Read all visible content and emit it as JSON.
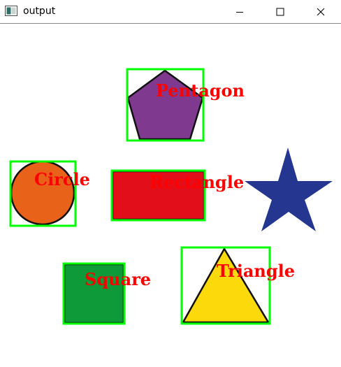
{
  "window": {
    "title": "output",
    "icon": "app-window-icon",
    "controls": {
      "minimize_icon": "minimize-icon",
      "maximize_icon": "maximize-icon",
      "close_icon": "close-icon"
    }
  },
  "canvas": {
    "background": "#ffffff",
    "bbox_color": "#00ff00",
    "label_color": "#ff0000",
    "shapes": {
      "pentagon": {
        "label": "Pentagon",
        "fill": "#7f3a8f"
      },
      "circle": {
        "label": "Circle",
        "fill": "#e8621a"
      },
      "rectangle": {
        "label": "Rectangle",
        "fill": "#e20f1a"
      },
      "star": {
        "fill": "#24368f"
      },
      "square": {
        "label": "Square",
        "fill": "#0f9a3a"
      },
      "triangle": {
        "label": "Triangle",
        "fill": "#fcd90a"
      }
    }
  }
}
